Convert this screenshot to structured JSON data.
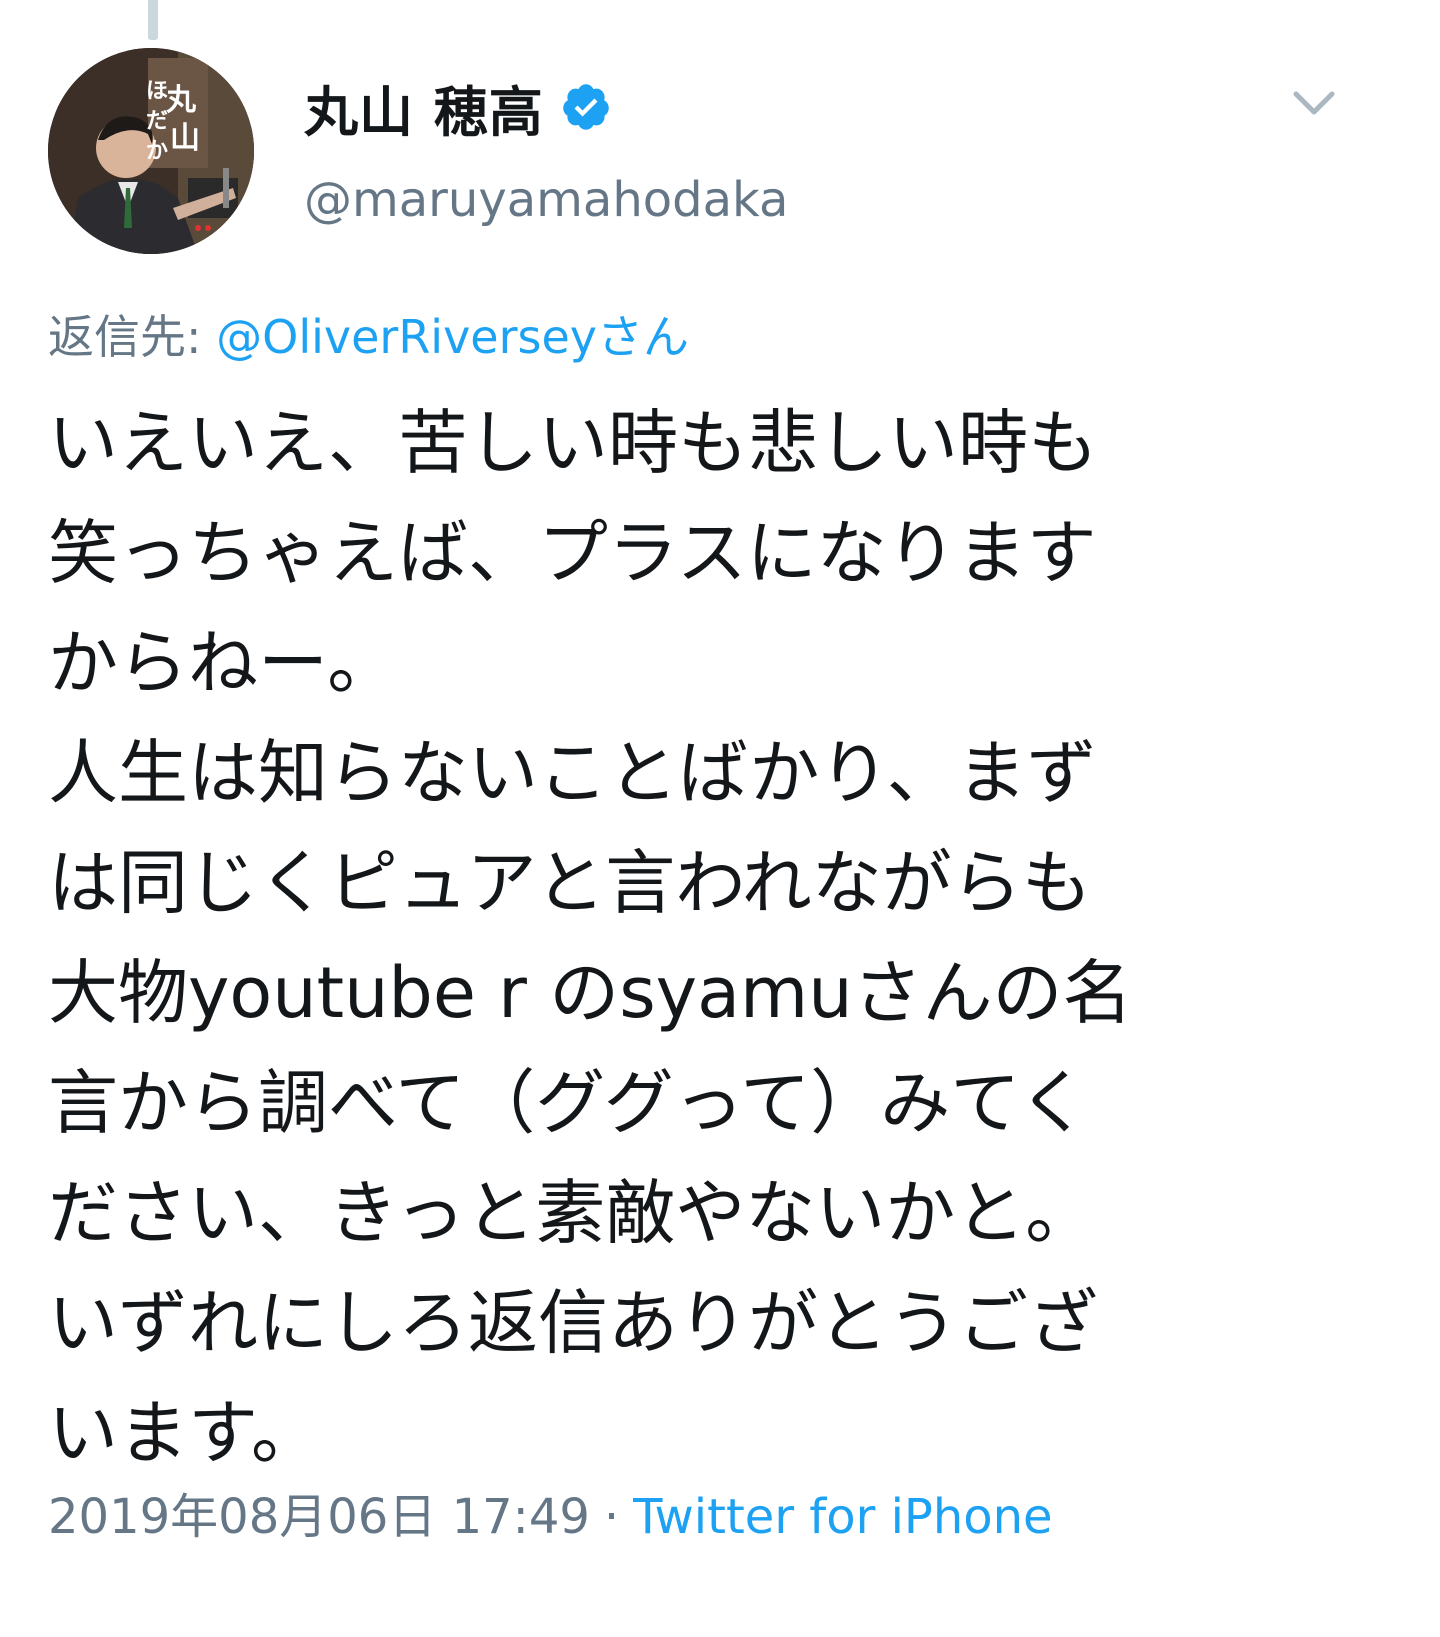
{
  "author": {
    "display_name": "丸山 穂高",
    "handle": "@maruyamahodaka",
    "verified": true,
    "avatar_icon": "profile-photo"
  },
  "reply": {
    "label": "返信先:",
    "target": "@OliverRiverseyさん"
  },
  "tweet": {
    "lines": [
      "いえいえ、苦しい時も悲しい時も",
      "笑っちゃえば、プラスになります",
      "からねー。",
      "人生は知らないことばかり、まず",
      "は同じくピュアと言われながらも",
      "大物youtube r のsyamuさんの名",
      "言から調べて（ググって）みてく",
      "ださい、きっと素敵やないかと。",
      "いずれにしろ返信ありがとうござ",
      "います。"
    ]
  },
  "meta": {
    "timestamp": "2019年08月06日 17:49",
    "separator": "·",
    "source": "Twitter for iPhone"
  },
  "icons": {
    "verified": "verified-badge-icon",
    "menu": "chevron-down-icon"
  },
  "colors": {
    "text_primary": "#14171a",
    "text_secondary": "#657786",
    "accent": "#1da1f2",
    "thread_line": "#ccd6dd"
  }
}
